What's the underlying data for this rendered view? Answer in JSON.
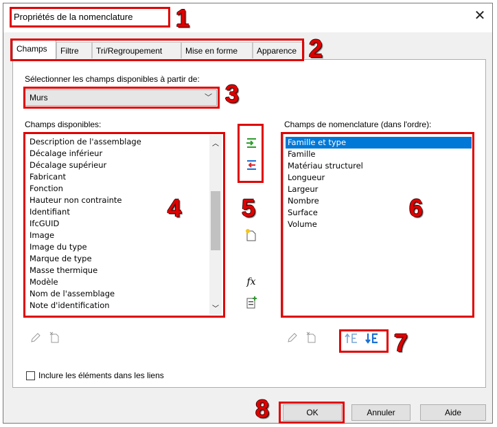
{
  "window": {
    "title": "Propriétés de la nomenclature",
    "close_icon": "close-icon"
  },
  "tabs": [
    {
      "label": "Champs",
      "active": true
    },
    {
      "label": "Filtre"
    },
    {
      "label": "Tri/Regroupement"
    },
    {
      "label": "Mise en forme"
    },
    {
      "label": "Apparence"
    }
  ],
  "source": {
    "label": "Sélectionner les champs disponibles à partir de:",
    "value": "Murs"
  },
  "available": {
    "label": "Champs disponibles:",
    "items": [
      "Description de l'assemblage",
      "Décalage inférieur",
      "Décalage supérieur",
      "Fabricant",
      "Fonction",
      "Hauteur non contrainte",
      "Identifiant",
      "IfcGUID",
      "Image",
      "Image du type",
      "Marque de type",
      "Masse thermique",
      "Modèle",
      "Nom de l'assemblage",
      "Note d'identification"
    ]
  },
  "scheduled": {
    "label": "Champs de nomenclature (dans l'ordre):",
    "items": [
      "Famille et type",
      "Famille",
      "Matériau structurel",
      "Longueur",
      "Largeur",
      "Nombre",
      "Surface",
      "Volume"
    ],
    "selected_index": 0
  },
  "fx_label": "fx",
  "include_links": {
    "label": "Inclure les éléments dans les liens",
    "checked": false
  },
  "buttons": {
    "ok": "OK",
    "cancel": "Annuler",
    "help": "Aide"
  },
  "callouts": [
    "1",
    "2",
    "3",
    "4",
    "5",
    "6",
    "7",
    "8"
  ],
  "colors": {
    "callout": "#e00000",
    "selection": "#0078d7",
    "arrow_green": "#2e9b2e",
    "arrow_red": "#d9262b",
    "move_blue": "#1a6fd1"
  }
}
